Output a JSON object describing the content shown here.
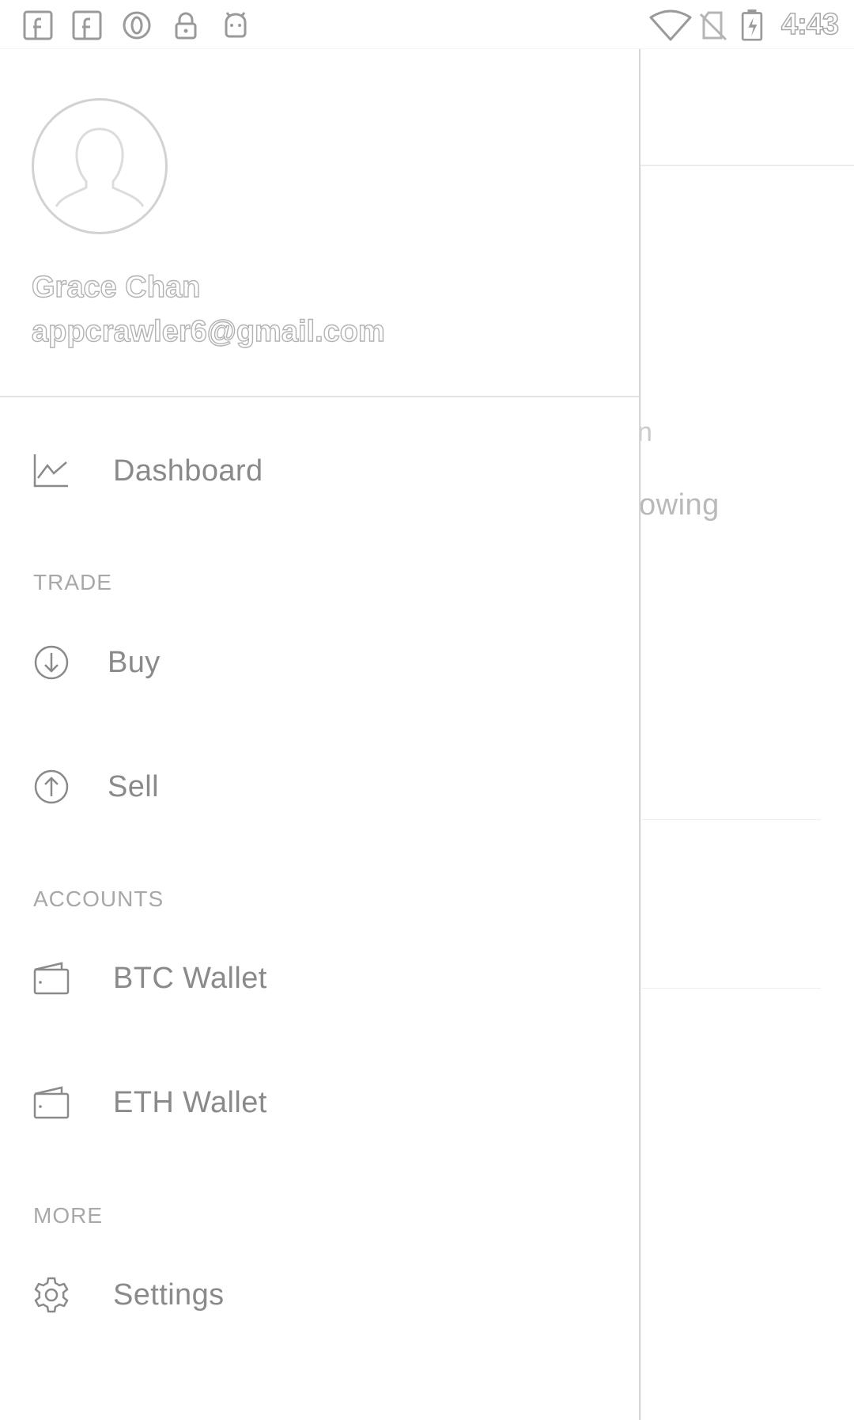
{
  "status_bar": {
    "time": "4:43",
    "left_icons": [
      "facebook-icon",
      "facebook-icon",
      "circle-notification-icon",
      "lock-icon",
      "android-icon"
    ],
    "right_icons": [
      "wifi-icon",
      "no-sim-icon",
      "battery-charging-icon"
    ]
  },
  "drawer": {
    "user": {
      "name": "Grace Chan",
      "email": "appcrawler6@gmail.com"
    },
    "items": {
      "dashboard": {
        "label": "Dashboard",
        "icon": "chart-line-icon"
      },
      "trade_header": "TRADE",
      "buy": {
        "label": "Buy",
        "icon": "arrow-down-circle-icon"
      },
      "sell": {
        "label": "Sell",
        "icon": "arrow-up-circle-icon"
      },
      "accounts_header": "ACCOUNTS",
      "btc_wallet": {
        "label": "BTC Wallet",
        "icon": "wallet-icon"
      },
      "eth_wallet": {
        "label": "ETH Wallet",
        "icon": "wallet-icon"
      },
      "more_header": "MORE",
      "settings": {
        "label": "Settings",
        "icon": "gear-icon"
      }
    }
  },
  "background": {
    "text_fragment": "owing",
    "glyph_fragment": "n"
  },
  "colors": {
    "label": "#8a8a8a",
    "section": "#a8a8a8",
    "outline": "#b2b2b2",
    "background": "#ffffff"
  }
}
